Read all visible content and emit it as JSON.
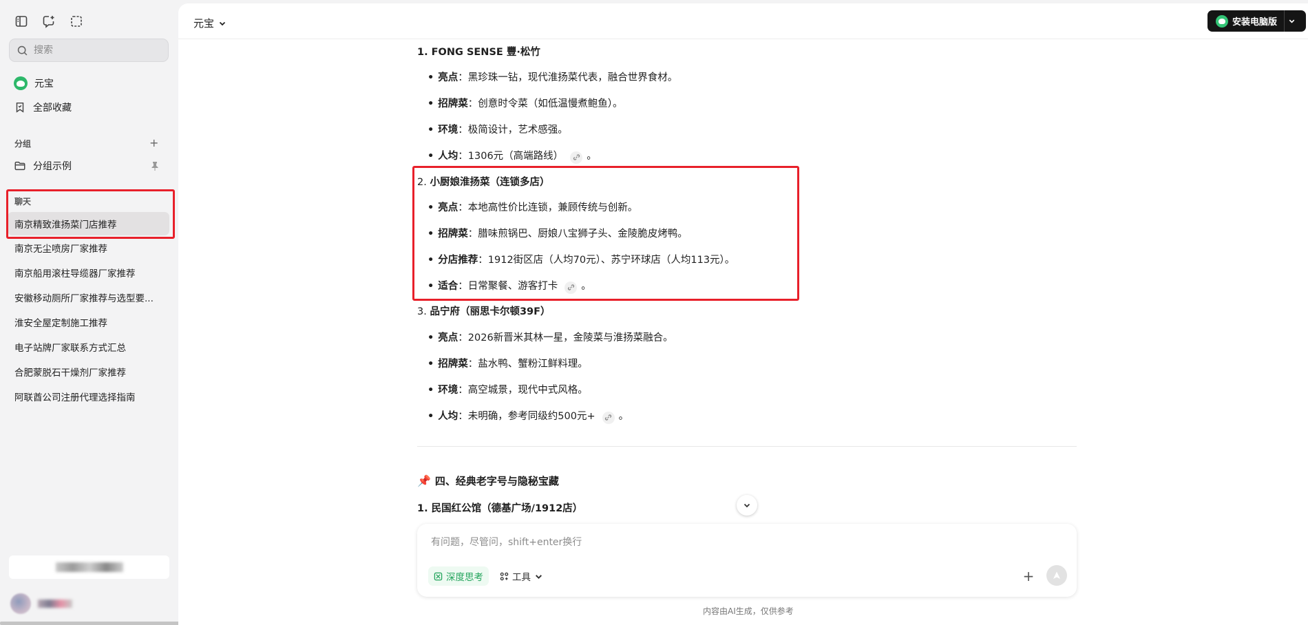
{
  "sidebar": {
    "search_placeholder": "搜索",
    "nav": [
      {
        "label": "元宝"
      },
      {
        "label": "全部收藏"
      }
    ],
    "groups_label": "分组",
    "group_item": "分组示例",
    "chats_label": "聊天",
    "chats": [
      "南京精致淮扬菜门店推荐",
      "南京无尘喷房厂家推荐",
      "南京船用滚柱导缆器厂家推荐",
      "安徽移动厕所厂家推荐与选型要...",
      "淮安全屋定制施工推荐",
      "电子站牌厂家联系方式汇总",
      "合肥蒙脱石干燥剂厂家推荐",
      "阿联酋公司注册代理选择指南"
    ]
  },
  "header": {
    "model": "元宝",
    "install_label": "安装电脑版"
  },
  "content": {
    "r1": {
      "title": "1. FONG SENSE 豐·松竹",
      "b1k": "亮点",
      "b1v": "：黑珍珠一钻，现代淮扬菜代表，融合世界食材。",
      "b2k": "招牌菜",
      "b2v": "：创意时令菜（如低温慢煮鲍鱼）。",
      "b3k": "环境",
      "b3v": "：极简设计，艺术感强。",
      "b4k": "人均",
      "b4v": "：1306元（高端路线）",
      "b4e": "。"
    },
    "r2": {
      "num": "2. ",
      "title": "小厨娘淮扬菜（连锁多店）",
      "b1k": "亮点",
      "b1v": "：本地高性价比连锁，兼顾传统与创新。",
      "b2k": "招牌菜",
      "b2v": "：腊味煎锅巴、厨娘八宝狮子头、金陵脆皮烤鸭。",
      "b3k": "分店推荐",
      "b3v": "：1912街区店（人均70元）、苏宁环球店（人均113元）。",
      "b4k": "适合",
      "b4v": "：日常聚餐、游客打卡",
      "b4e": "。"
    },
    "r3": {
      "num": "3. ",
      "title": "品宁府（丽思卡尔顿39F）",
      "b1k": "亮点",
      "b1v": "：2026新晋米其林一星，金陵菜与淮扬菜融合。",
      "b2k": "招牌菜",
      "b2v": "：盐水鸭、蟹粉江鲜料理。",
      "b3k": "环境",
      "b3v": "：高空城景，现代中式风格。",
      "b4k": "人均",
      "b4v": "：未明确，参考同级约500元+",
      "b4e": "。"
    },
    "section4": "四、经典老字号与隐秘宝藏",
    "r4": {
      "title": "1. 民国红公馆（德基广场/1912店）"
    }
  },
  "composer": {
    "placeholder": "有问题，尽管问，shift+enter换行",
    "deep_think": "深度思考",
    "tools": "工具"
  },
  "disclaimer": "内容由AI生成，仅供参考",
  "colors": {
    "accent_green": "#23a45c",
    "highlight_red": "#e8202a",
    "install_btn_bg": "#151515"
  }
}
